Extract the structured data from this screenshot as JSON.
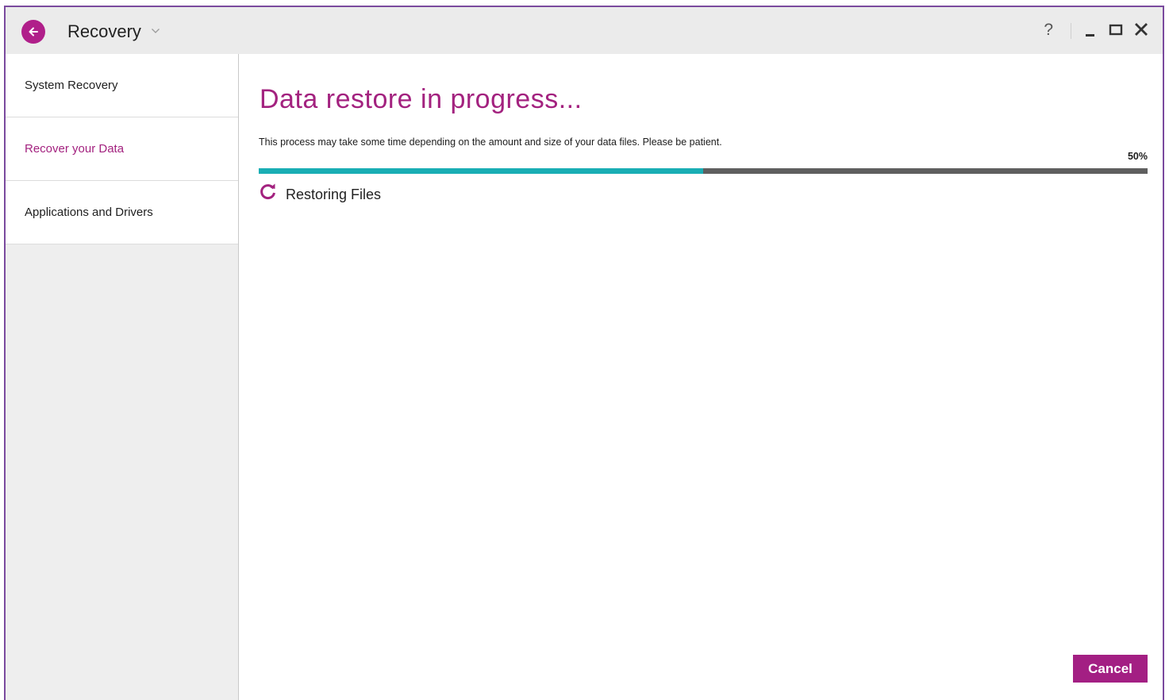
{
  "window": {
    "title": "Recovery",
    "help_label": "?"
  },
  "sidebar": {
    "items": [
      {
        "label": "System Recovery",
        "active": false
      },
      {
        "label": "Recover your Data",
        "active": true
      },
      {
        "label": "Applications and Drivers",
        "active": false
      }
    ]
  },
  "main": {
    "title": "Data restore in progress...",
    "description": "This process may take some time depending on the amount and size of your data files. Please be patient.",
    "progress_percent_label": "50%",
    "progress_value": 0.5,
    "status_text": "Restoring Files",
    "cancel_label": "Cancel"
  },
  "icons": {
    "back": "arrow-left-icon",
    "title_dropdown": "chevron-down-icon",
    "minimize": "minimize-icon",
    "maximize": "maximize-icon",
    "close": "close-icon",
    "status": "refresh-icon"
  },
  "colors": {
    "accent": "#a3227f",
    "progress_fill": "#19aeb4",
    "progress_track": "#5f5f5f",
    "window_border": "#7a4a9e"
  }
}
